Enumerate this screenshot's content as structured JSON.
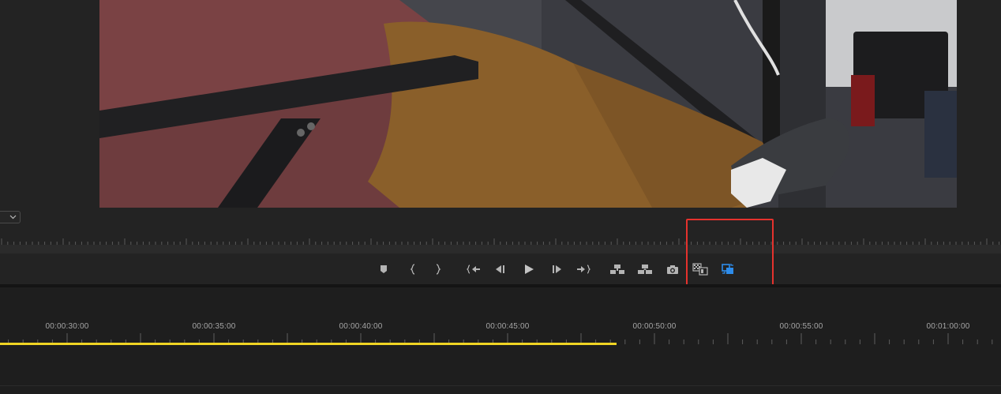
{
  "program_monitor": {
    "frame_description_icon": "video-frame",
    "zoom_dropdown_icon": "chevron-down-icon"
  },
  "transport": {
    "buttons": [
      {
        "name": "add-marker-button",
        "icon": "marker-icon",
        "tooltip": ""
      },
      {
        "name": "mark-in-button",
        "icon": "mark-in-icon",
        "tooltip": ""
      },
      {
        "name": "mark-out-button",
        "icon": "mark-out-icon",
        "tooltip": ""
      },
      {
        "name": "go-to-in-button",
        "icon": "go-to-in-icon",
        "tooltip": ""
      },
      {
        "name": "step-back-button",
        "icon": "step-back-icon",
        "tooltip": ""
      },
      {
        "name": "play-button",
        "icon": "play-icon",
        "tooltip": ""
      },
      {
        "name": "step-forward-button",
        "icon": "step-forward-icon",
        "tooltip": ""
      },
      {
        "name": "go-to-out-button",
        "icon": "go-to-out-icon",
        "tooltip": ""
      },
      {
        "name": "lift-button",
        "icon": "lift-icon",
        "tooltip": ""
      },
      {
        "name": "extract-button",
        "icon": "extract-icon",
        "tooltip": ""
      },
      {
        "name": "export-frame-button",
        "icon": "camera-icon",
        "tooltip": ""
      },
      {
        "name": "comparison-view-button",
        "icon": "comparison-view-icon",
        "tooltip": ""
      },
      {
        "name": "proxy-toggle-button",
        "icon": "proxy-toggle-icon",
        "tooltip": "",
        "active": true
      }
    ],
    "highlight_color": "#e5322d",
    "active_color": "#2d8ceb"
  },
  "timeline": {
    "timecodes": [
      "00:00:30:00",
      "00:00:35:00",
      "00:00:40:00",
      "00:00:45:00",
      "00:00:50:00",
      "00:00:55:00",
      "00:01:00:00"
    ],
    "work_area_color": "#f0d424"
  }
}
